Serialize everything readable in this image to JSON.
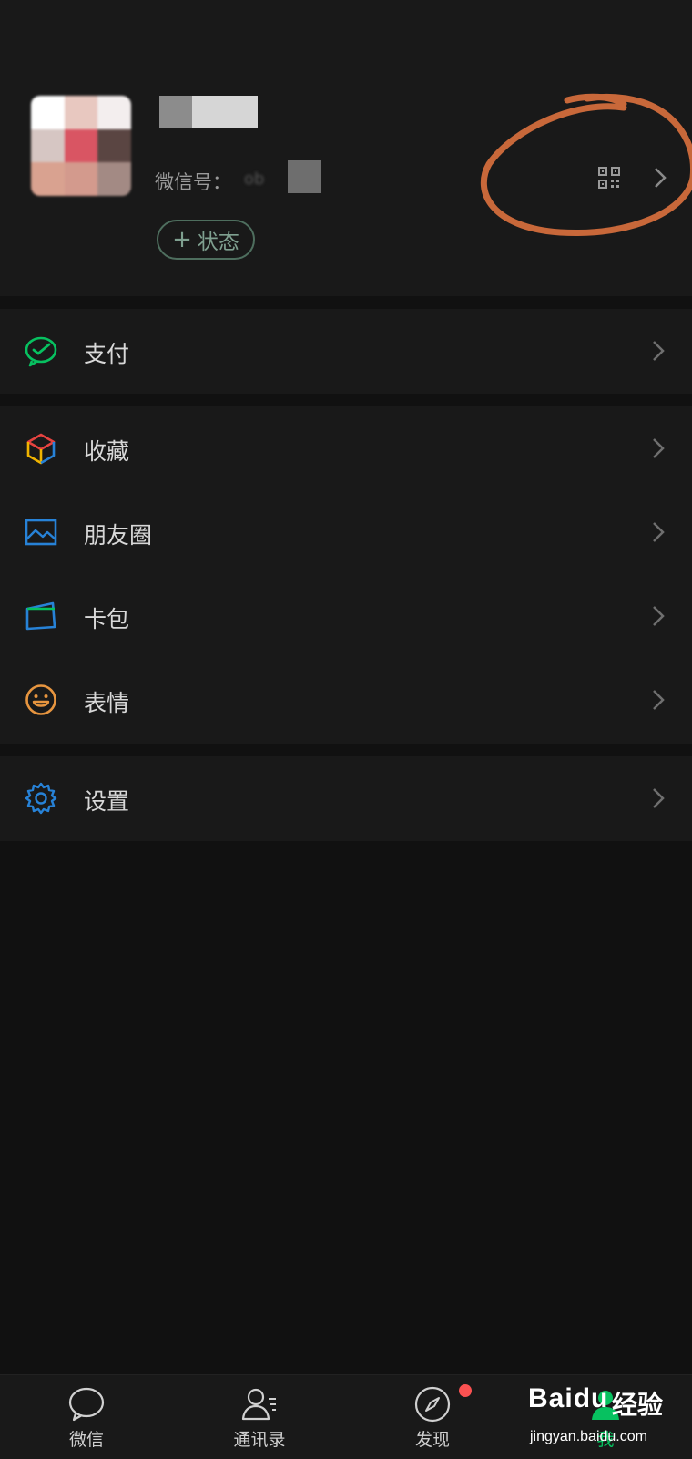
{
  "profile": {
    "wechat_id_label": "微信号：",
    "wechat_id_value": "ob",
    "status_label": "状态",
    "status_plus": "+"
  },
  "menu": {
    "pay": {
      "label": "支付",
      "icon": "wechat-pay-icon"
    },
    "favorites": {
      "label": "收藏",
      "icon": "favorites-cube-icon"
    },
    "moments": {
      "label": "朋友圈",
      "icon": "moments-picture-icon"
    },
    "cards": {
      "label": "卡包",
      "icon": "card-wallet-icon"
    },
    "stickers": {
      "label": "表情",
      "icon": "sticker-smile-icon"
    },
    "settings": {
      "label": "设置",
      "icon": "gear-icon"
    }
  },
  "tabs": [
    {
      "label": "微信",
      "icon": "chat-bubble-icon"
    },
    {
      "label": "通讯录",
      "icon": "contacts-icon"
    },
    {
      "label": "发现",
      "icon": "compass-icon",
      "badge": true
    },
    {
      "label": "我",
      "icon": "me-icon",
      "active": true
    }
  ],
  "watermark": {
    "brand": "Bai",
    "brand_du": "du",
    "cn": "经验",
    "url": "jingyan.baidu.com"
  },
  "colors": {
    "background": "#111111",
    "panel": "#191919",
    "accent_green": "#07c160",
    "annotation_orange": "#c8683a",
    "badge_red": "#fa5151"
  }
}
